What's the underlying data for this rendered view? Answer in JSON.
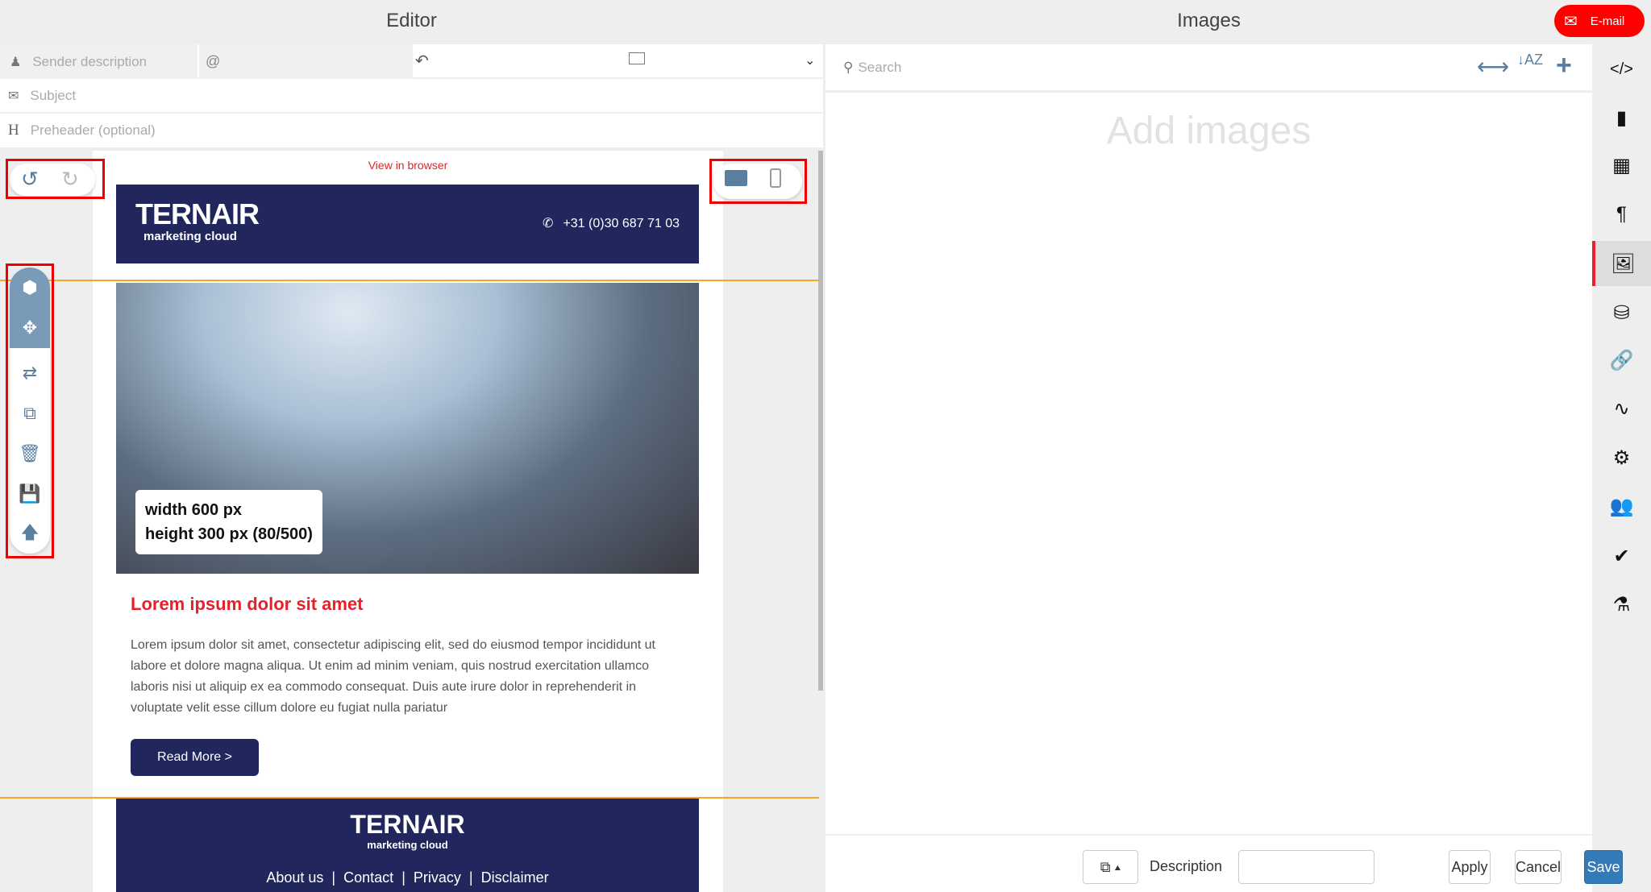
{
  "editor": {
    "title": "Editor",
    "sender_placeholder": "Sender description",
    "at_symbol": "@",
    "subject_placeholder": "Subject",
    "preheader_placeholder": "Preheader (optional)",
    "preheader_icon": "H"
  },
  "email": {
    "view_in_browser": "View in browser",
    "logo_main": "TERNAIR",
    "logo_sub": "marketing cloud",
    "phone": "+31 (0)30 687 71 03",
    "image_label_1": "width 600 px",
    "image_label_2": "height 300 px (80/500)",
    "heading": "Lorem ipsum dolor sit amet",
    "body": "Lorem ipsum dolor sit amet, consectetur adipiscing elit, sed do eiusmod tempor incididunt ut labore et dolore magna aliqua. Ut enim ad minim veniam, quis nostrud exercitation ullamco laboris nisi ut aliquip ex ea commodo consequat. Duis aute irure dolor in reprehenderit in voluptate velit esse cillum dolore eu fugiat nulla pariatur",
    "button": "Read More >",
    "footer_links": [
      "About us",
      "Contact",
      "Privacy",
      "Disclaimer"
    ],
    "sep": "|"
  },
  "images": {
    "title": "Images",
    "search_placeholder": "Search",
    "empty": "Add images",
    "badge": "E-mail"
  },
  "footer": {
    "description_label": "Description",
    "description_value": "",
    "apply": "Apply",
    "cancel": "Cancel",
    "save": "Save"
  },
  "colors": {
    "accent": "#337ab7",
    "brand_navy": "#21275c",
    "red": "#e6212a"
  }
}
